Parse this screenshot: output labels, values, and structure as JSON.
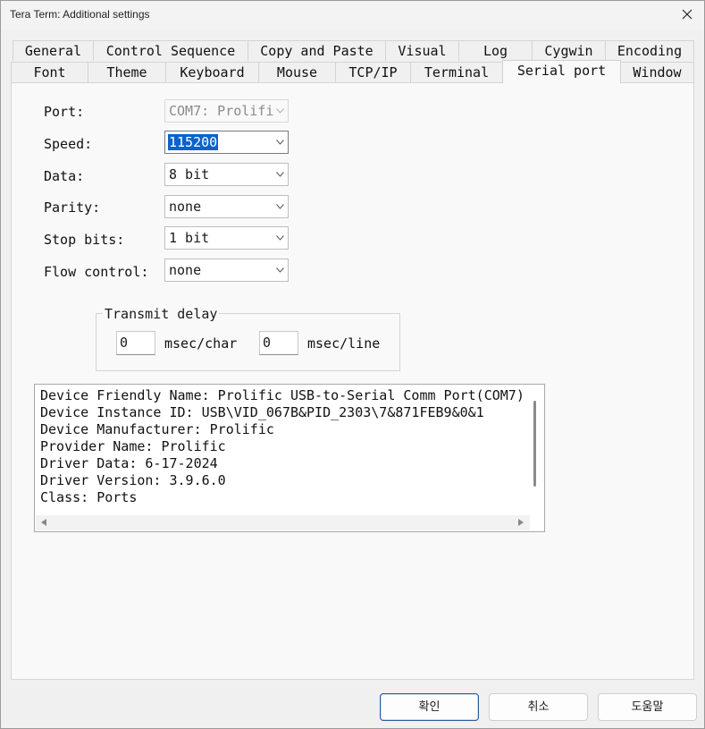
{
  "window": {
    "title": "Tera Term: Additional settings"
  },
  "tabs": {
    "row1": [
      "General",
      "Control Sequence",
      "Copy and Paste",
      "Visual",
      "Log",
      "Cygwin",
      "Encoding"
    ],
    "row2": [
      "Font",
      "Theme",
      "Keyboard",
      "Mouse",
      "TCP/IP",
      "Terminal",
      "Serial port",
      "Window"
    ],
    "active": "Serial port"
  },
  "serial": {
    "port_label": "Port:",
    "port_value": "COM7: Prolifi",
    "speed_label": "Speed:",
    "speed_value": "115200",
    "data_label": "Data:",
    "data_value": "8 bit",
    "parity_label": "Parity:",
    "parity_value": "none",
    "stopbits_label": "Stop bits:",
    "stopbits_value": "1 bit",
    "flow_label": "Flow control:",
    "flow_value": "none"
  },
  "transmit_delay": {
    "title": "Transmit delay",
    "char_value": "0",
    "char_unit": "msec/char",
    "line_value": "0",
    "line_unit": "msec/line"
  },
  "device_info": [
    "Device Friendly Name: Prolific USB-to-Serial Comm Port(COM7)",
    "Device Instance ID: USB\\VID_067B&PID_2303\\7&871FEB9&0&1",
    "Device Manufacturer: Prolific",
    "Provider Name: Prolific",
    "Driver Data: 6-17-2024",
    "Driver Version: 3.9.6.0",
    "Class: Ports"
  ],
  "buttons": {
    "ok": "확인",
    "cancel": "취소",
    "help": "도움말"
  },
  "colors": {
    "selection": "#0a63c9",
    "default_button_border": "#2c5c9a"
  }
}
